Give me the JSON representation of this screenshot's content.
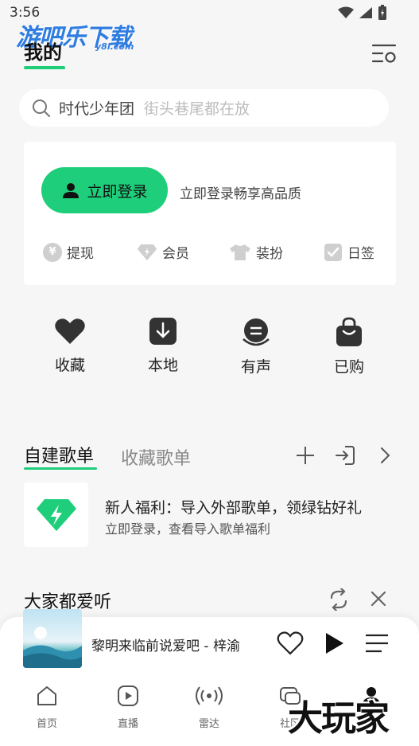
{
  "status_bar": {
    "time": "3:56"
  },
  "watermark": {
    "top_text": "游吧乐下载",
    "top_sub": "y8l.com",
    "bottom_text": "大玩家"
  },
  "header": {
    "title": "我的"
  },
  "search": {
    "hot_word": "时代少年团",
    "placeholder": "街头巷尾都在放"
  },
  "login_card": {
    "login_label": "立即登录",
    "hint": "立即登录畅享高品质",
    "actions": [
      {
        "label": "提现",
        "icon": "yuan-icon"
      },
      {
        "label": "会员",
        "icon": "diamond-icon"
      },
      {
        "label": "装扮",
        "icon": "shirt-icon"
      },
      {
        "label": "日签",
        "icon": "check-icon"
      }
    ]
  },
  "quick_access": [
    {
      "label": "收藏",
      "icon": "heart-icon"
    },
    {
      "label": "本地",
      "icon": "download-icon"
    },
    {
      "label": "有声",
      "icon": "podcast-icon"
    },
    {
      "label": "已购",
      "icon": "bag-icon"
    }
  ],
  "playlists": {
    "tab_active": "自建歌单",
    "tab_inactive": "收藏歌单",
    "promo_title": "新人福利：导入外部歌单，领绿钻好礼",
    "promo_subtitle": "立即登录，查看导入歌单福利"
  },
  "recommend": {
    "title": "大家都爱听"
  },
  "player": {
    "song": "黎明来临前说爱吧 - 梓渝"
  },
  "bottom_nav": [
    {
      "label": "首页",
      "icon": "home-icon"
    },
    {
      "label": "直播",
      "icon": "live-icon"
    },
    {
      "label": "雷达",
      "icon": "radar-icon"
    },
    {
      "label": "社区",
      "icon": "community-icon"
    },
    {
      "label": "我的",
      "icon": "profile-icon"
    }
  ],
  "colors": {
    "accent": "#1ece7a",
    "background": "#f6f6f6"
  }
}
